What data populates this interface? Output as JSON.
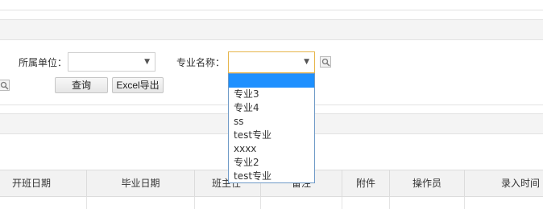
{
  "filters": {
    "unit_label": "所属单位：",
    "unit_value": "",
    "major_label": "专业名称：",
    "major_value": ""
  },
  "buttons": {
    "query": "查询",
    "excel_export": "Excel导出"
  },
  "major_dropdown": {
    "options": [
      "",
      "专业3",
      "专业4",
      "ss",
      "test专业",
      "xxxx",
      "专业2",
      "test专业"
    ],
    "highlighted_index": 0
  },
  "table": {
    "columns": [
      "开班日期",
      "毕业日期",
      "班主任",
      "备注",
      "附件",
      "操作员",
      "录入时间"
    ]
  },
  "colors": {
    "highlight": "#1e90ff",
    "active_border": "#e6b54a",
    "dropdown_border": "#6f9ac7"
  }
}
